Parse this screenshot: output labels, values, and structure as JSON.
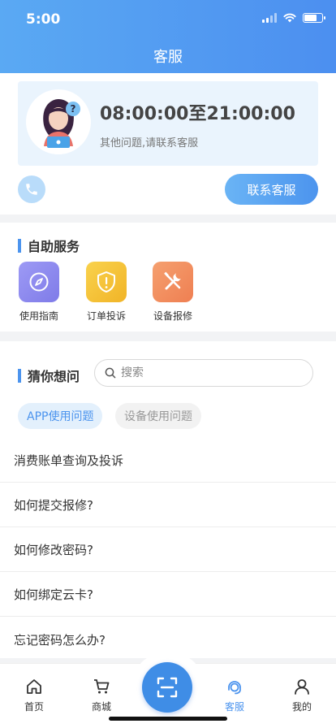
{
  "status_bar": {
    "time": "5:00"
  },
  "header": {
    "title": "客服"
  },
  "contact": {
    "hours": "08:00:00至21:00:00",
    "subtitle": "其他问题,请联系客服",
    "contact_button": "联系客服"
  },
  "self_service": {
    "title": "自助服务",
    "items": [
      {
        "label": "使用指南",
        "icon": "compass-icon",
        "color": "#8f8cf1"
      },
      {
        "label": "订单投诉",
        "icon": "shield-alert-icon",
        "color": "#f5c23a"
      },
      {
        "label": "设备报修",
        "icon": "tools-icon",
        "color": "#f38a5c"
      }
    ]
  },
  "guess": {
    "title": "猜你想问",
    "search_placeholder": "搜索",
    "tabs": [
      {
        "label": "APP使用问题",
        "active": true
      },
      {
        "label": "设备使用问题",
        "active": false
      }
    ],
    "questions": [
      "消费账单查询及投诉",
      "如何提交报修?",
      "如何修改密码?",
      "如何绑定云卡?",
      "忘记密码怎么办?"
    ]
  },
  "tabbar": {
    "items": [
      {
        "label": "首页",
        "icon": "home-icon"
      },
      {
        "label": "商城",
        "icon": "cart-icon"
      },
      {
        "label": "客服",
        "icon": "support-icon",
        "active": true
      },
      {
        "label": "我的",
        "icon": "user-icon"
      }
    ],
    "scan_icon": "scan-icon"
  },
  "colors": {
    "accent": "#4c94ee",
    "header_start": "#5aa9f3",
    "header_end": "#4c8ff0"
  }
}
